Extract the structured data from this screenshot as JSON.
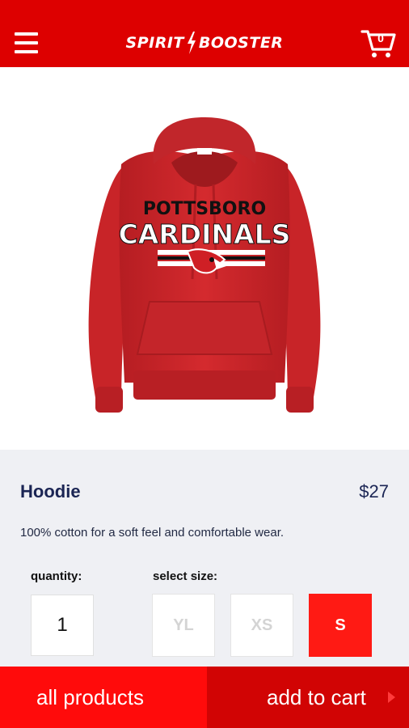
{
  "header": {
    "logo_text_left": "SPIRIT",
    "logo_text_right": "BOOSTER",
    "cart_count": "0",
    "menu_icon": "hamburger-menu-icon",
    "cart_icon": "shopping-cart-icon"
  },
  "product": {
    "image_text_top": "POTTSBORO",
    "image_text_main": "CARDINALS",
    "name": "Hoodie",
    "price": "$27",
    "description": "100% cotton for a soft feel and comfortable wear.",
    "color": "#d42a2e"
  },
  "options": {
    "quantity_label": "quantity:",
    "quantity_value": "1",
    "size_label": "select size:",
    "sizes": [
      "YL",
      "XS",
      "S"
    ],
    "selected_size": "S"
  },
  "footer": {
    "all_products_label": "all products",
    "add_to_cart_label": "add to cart"
  },
  "colors": {
    "brand_red": "#dd0000",
    "button_red": "#ff0b0b",
    "button_dark_red": "#d10404",
    "text_navy": "#1b2554",
    "panel_gray": "#eff0f4"
  }
}
